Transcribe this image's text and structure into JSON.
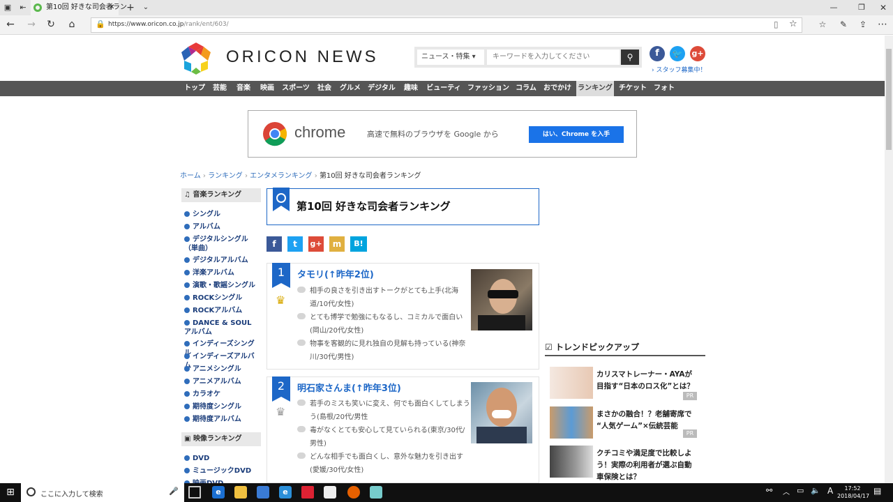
{
  "browser": {
    "tab_title": "第10回 好きな司会者ラン",
    "url_host": "https://www.oricon.co.jp",
    "url_path": "/rank/ent/603/"
  },
  "header": {
    "logo_text": "ORICON NEWS",
    "search_category": "ニュース・特集",
    "search_placeholder": "キーワードを入力してください",
    "staff_link": "スタッフ募集中！"
  },
  "nav": [
    "トップ",
    "芸能",
    "音楽",
    "映画",
    "スポーツ",
    "社会",
    "グルメ",
    "デジタル",
    "趣味",
    "ビューティ",
    "ファッション",
    "コラム",
    "おでかけ",
    "ランキング",
    "チケット",
    "フォト"
  ],
  "ad": {
    "brand": "chrome",
    "text": "高速で無料のブラウザを Google から",
    "button": "はい、Chrome を入手"
  },
  "breadcrumb": [
    "ホーム",
    "ランキング",
    "エンタメランキング",
    "第10回 好きな司会者ランキング"
  ],
  "sidebar": {
    "music_heading": "音楽ランキング",
    "music_items": [
      "シングル",
      "アルバム",
      "デジタルシングル（単曲）",
      "デジタルアルバム",
      "洋楽アルバム",
      "演歌・歌謡シングル",
      "ROCKシングル",
      "ROCKアルバム",
      "DANCE & SOUL アルバム",
      "インディーズシングル",
      "インディーズアルバム",
      "アニメシングル",
      "アニメアルバム",
      "カラオケ",
      "期待度シングル",
      "期待度アルバム"
    ],
    "video_heading": "映像ランキング",
    "video_items": [
      "DVD",
      "ミュージックDVD",
      "映画DVD"
    ]
  },
  "main": {
    "title": "第10回 好きな司会者ランキング",
    "share": [
      "f",
      "t",
      "g+",
      "m",
      "B!"
    ],
    "entries": [
      {
        "rank": "1",
        "name": "タモリ(↑昨年2位)",
        "comments": [
          "相手の良さを引き出すトークがとても上手(北海",
          "道/10代/女性)",
          "とても博学で勉強にもなるし、コミカルで面白い",
          "(岡山/20代/女性)",
          "物事を客観的に見れ独自の見解も持っている(神奈",
          "川/30代/男性)"
        ]
      },
      {
        "rank": "2",
        "name": "明石家さんま(↑昨年3位)",
        "comments": [
          "若手のミスも笑いに変え、何でも面白くしてしまう",
          "う(島根/20代/男性",
          "毒がなくとても安心して見ていられる(東京/30代/",
          "男性)",
          "どんな相手でも面白くし、意外な魅力を引き出す",
          "(愛媛/30代/女性)"
        ]
      }
    ]
  },
  "trend": {
    "heading": "トレンドピックアップ",
    "items": [
      {
        "text1": "カリスマトレーナー・AYAが",
        "text2": "目指す“日本のロス化”とは？",
        "badge": "PR"
      },
      {
        "text1": "まさかの融合！？老舗寄席で",
        "text2": "“人気ゲーム”×伝統芸能",
        "badge": "PR"
      },
      {
        "text1": "クチコミや満足度で比較しよ",
        "text2": "う！実際の利用者が選ぶ自動",
        "text3": "車保険とは？"
      }
    ]
  },
  "taskbar": {
    "search_placeholder": "ここに入力して検索",
    "time": "17:52",
    "date": "2018/04/17",
    "ime": "A"
  },
  "colors": {
    "accent_blue": "#1d67c7",
    "nav_bg": "#555555",
    "link": "#2f6dbb"
  }
}
